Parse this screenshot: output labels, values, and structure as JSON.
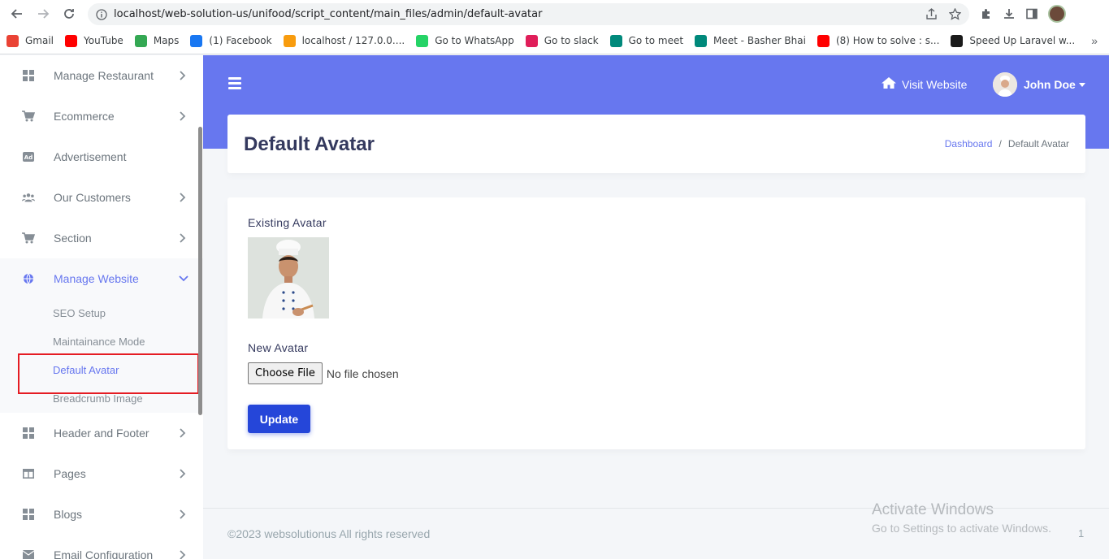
{
  "browser": {
    "url": "localhost/web-solution-us/unifood/script_content/main_files/admin/default-avatar",
    "bookmarks": [
      {
        "label": "Gmail",
        "color": "#ea4335"
      },
      {
        "label": "YouTube",
        "color": "#ff0000"
      },
      {
        "label": "Maps",
        "color": "#34a853"
      },
      {
        "label": "(1) Facebook",
        "color": "#1877f2"
      },
      {
        "label": "localhost / 127.0.0....",
        "color": "#f89c0e"
      },
      {
        "label": "Go to WhatsApp",
        "color": "#25d366"
      },
      {
        "label": "Go to slack",
        "color": "#e01e5a"
      },
      {
        "label": "Go to meet",
        "color": "#00897b"
      },
      {
        "label": "Meet - Basher Bhai",
        "color": "#00897b"
      },
      {
        "label": "(8) How to solve : s...",
        "color": "#ff0000"
      },
      {
        "label": "Speed Up Laravel w...",
        "color": "#1a1a1a"
      }
    ],
    "more": "»"
  },
  "sidebar": {
    "items_top": [
      {
        "label": "Manage Restaurant",
        "icon": "grid-icon",
        "glyph": "▦",
        "chevron": true
      },
      {
        "label": "Ecommerce",
        "icon": "cart-icon",
        "glyph": "🛒",
        "chevron": true
      },
      {
        "label": "Advertisement",
        "icon": "ad-icon",
        "glyph": "Ad",
        "chevron": false
      },
      {
        "label": "Our Customers",
        "icon": "users-icon",
        "glyph": "👥",
        "chevron": true
      },
      {
        "label": "Section",
        "icon": "cart-icon",
        "glyph": "🛒",
        "chevron": true
      }
    ],
    "active_group": {
      "label": "Manage Website",
      "icon": "globe-icon",
      "subitems": [
        "SEO Setup",
        "Maintainance Mode",
        "Default Avatar",
        "Breadcrumb Image"
      ],
      "active_sub": "Default Avatar"
    },
    "items_bottom": [
      {
        "label": "Header and Footer",
        "icon": "grid-icon",
        "chevron": true
      },
      {
        "label": "Pages",
        "icon": "columns-icon",
        "chevron": true
      },
      {
        "label": "Blogs",
        "icon": "grid-icon",
        "chevron": true
      },
      {
        "label": "Email Configuration",
        "icon": "envelope-icon",
        "chevron": true
      }
    ]
  },
  "navbar": {
    "visit_website": "Visit Website",
    "user_name": "John Doe",
    "accent": "#6777ef"
  },
  "header": {
    "title": "Default Avatar",
    "breadcrumb_home": "Dashboard",
    "breadcrumb_sep": "/",
    "breadcrumb_current": "Default Avatar"
  },
  "form": {
    "existing_label": "Existing Avatar",
    "new_label": "New Avatar",
    "choose_file": "Choose File",
    "file_status": "No file chosen",
    "submit": "Update"
  },
  "footer": {
    "copyright": "©2023 websolutionus All rights reserved",
    "version": "1"
  },
  "watermark": {
    "line1": "Activate Windows",
    "line2": "Go to Settings to activate Windows."
  }
}
